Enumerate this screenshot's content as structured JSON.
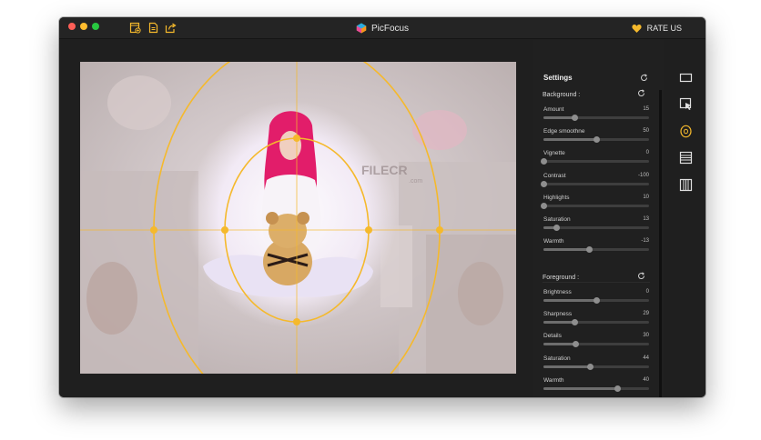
{
  "window": {
    "title": "PicFocus",
    "rate_label": "RATE US",
    "accent_color": "#f5b92c"
  },
  "toolbar": {
    "icons": [
      "add-image-icon",
      "document-icon",
      "share-icon"
    ]
  },
  "settings": {
    "title": "Settings",
    "background": {
      "title": "Background :",
      "sliders": [
        {
          "label": "Amount",
          "value": 15,
          "level": 0.29
        },
        {
          "label": "Edge smoothne",
          "value": 50,
          "level": 0.5
        },
        {
          "label": "Vignette",
          "value": 0,
          "level": 0.0
        },
        {
          "label": "Contrast",
          "value": -100,
          "level": 0.0
        },
        {
          "label": "Highlights",
          "value": 10,
          "level": 0.0
        },
        {
          "label": "Saturation",
          "value": 13,
          "level": 0.12
        },
        {
          "label": "Warmth",
          "value": -13,
          "level": 0.43
        }
      ]
    },
    "foreground": {
      "title": "Foreground :",
      "sliders": [
        {
          "label": "Brightness",
          "value": 0,
          "level": 0.5
        },
        {
          "label": "Sharpness",
          "value": 29,
          "level": 0.29
        },
        {
          "label": "Details",
          "value": 30,
          "level": 0.3
        },
        {
          "label": "Saturation",
          "value": 44,
          "level": 0.44
        },
        {
          "label": "Warmth",
          "value": 40,
          "level": 0.7
        }
      ]
    }
  },
  "tools": [
    "rectangle-icon",
    "select-area-icon",
    "radial-focus-icon",
    "horizontal-lines-icon",
    "vertical-lines-icon"
  ],
  "watermark": {
    "brand": "FILECR",
    "suffix": ".com"
  }
}
